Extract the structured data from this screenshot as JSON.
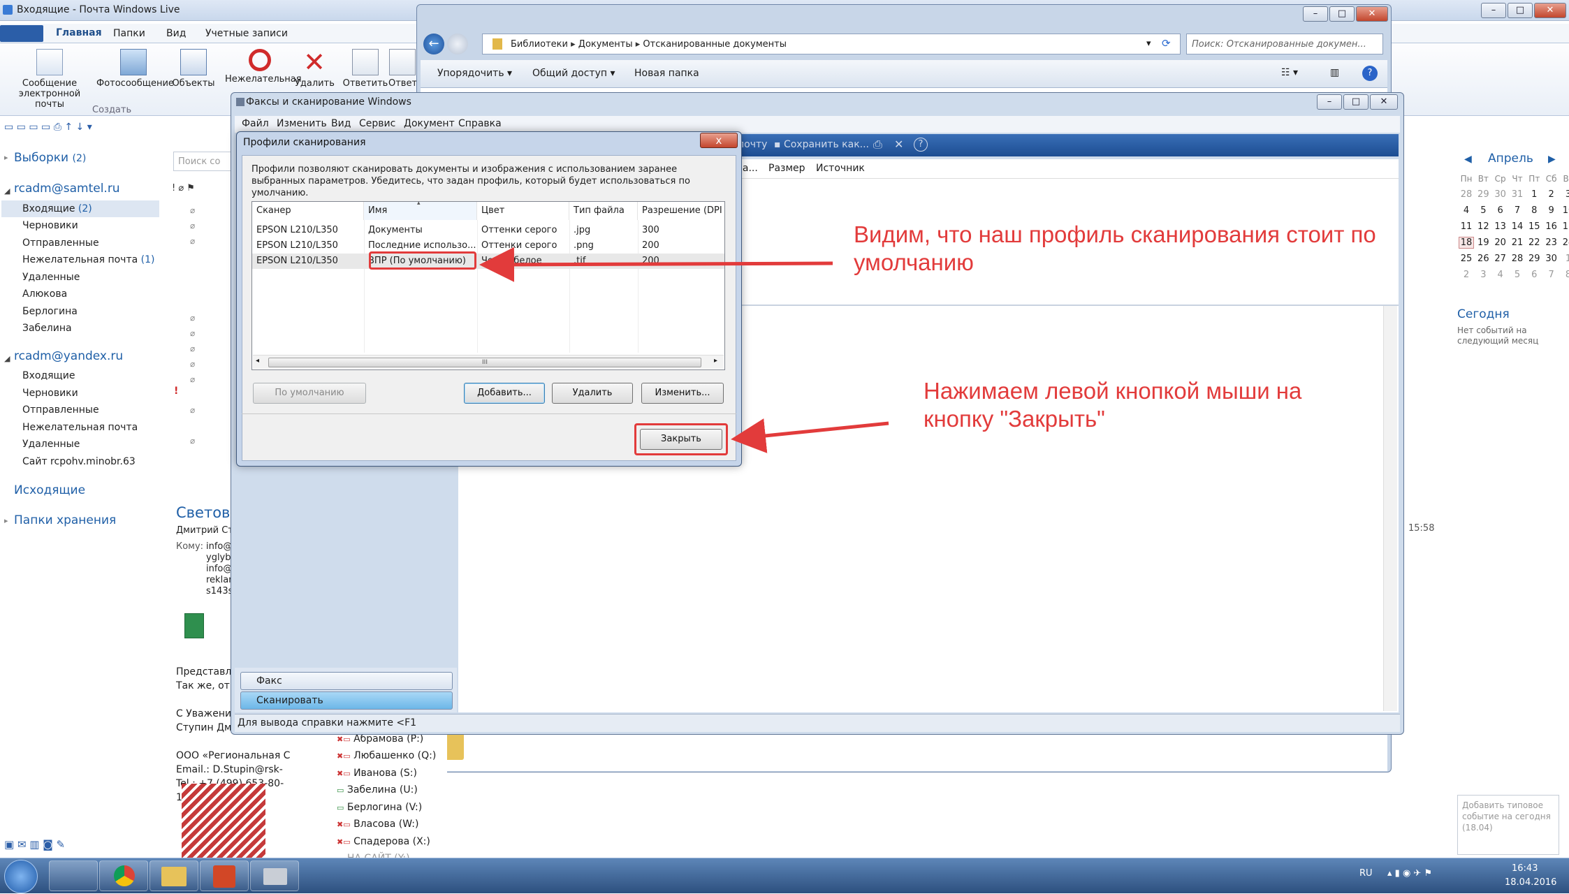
{
  "wlm": {
    "title": "Входящие - Почта Windows Live",
    "tabs": [
      "Главная",
      "Папки",
      "Вид",
      "Учетные записи"
    ],
    "ribbon": {
      "new_email": "Сообщение электронной почты",
      "photo_email": "Фотосообщение",
      "objects": "Объекты",
      "group_create": "Создать",
      "junk": "Нежелательная",
      "delete": "Удалить",
      "reply": "Ответить",
      "reply_all": "Ответ"
    },
    "search_placeholder": "Поиск со",
    "nav": {
      "quick_views": "Выборки",
      "quick_views_count": "(2)",
      "account1": "rcadm@samtel.ru",
      "account1_folders": [
        {
          "label": "Входящие",
          "count": "(2)"
        },
        {
          "label": "Черновики",
          "count": ""
        },
        {
          "label": "Отправленные",
          "count": ""
        },
        {
          "label": "Нежелательная почта",
          "count": "(1)"
        },
        {
          "label": "Удаленные",
          "count": ""
        },
        {
          "label": "Алюкова",
          "count": ""
        },
        {
          "label": "Берлогина",
          "count": ""
        },
        {
          "label": "Забелина",
          "count": ""
        }
      ],
      "account2": "rcadm@yandex.ru",
      "account2_folders": [
        "Входящие",
        "Черновики",
        "Отправленные",
        "Нежелательная почта",
        "Удаленные",
        "Сайт rcpohv.minobr.63"
      ],
      "outbox": "Исходящие",
      "storage": "Папки хранения"
    },
    "reading": {
      "subject": "Светово",
      "from": "Дмитрий Ст",
      "to_label": "Кому:",
      "to_lines": [
        "info@",
        "yglyb",
        "info@",
        "reklar",
        "s143s"
      ],
      "body": [
        "Представл",
        "Так же, отп",
        "",
        "С Уважени",
        "Ступин Дм",
        "",
        "ООО «Региональная С",
        "Email.: D.Stupin@rsk-",
        "Tel.: +7 (499) 653-80-15"
      ],
      "time": "15:58"
    },
    "calendar": {
      "month": "Апрель",
      "weekdays": [
        "Пн",
        "Вт",
        "Ср",
        "Чт",
        "Пт",
        "Сб",
        "Вс"
      ],
      "weeks": [
        [
          "28",
          "29",
          "30",
          "31",
          "1",
          "2",
          "3"
        ],
        [
          "4",
          "5",
          "6",
          "7",
          "8",
          "9",
          "10"
        ],
        [
          "11",
          "12",
          "13",
          "14",
          "15",
          "16",
          "17"
        ],
        [
          "18",
          "19",
          "20",
          "21",
          "22",
          "23",
          "24"
        ],
        [
          "25",
          "26",
          "27",
          "28",
          "29",
          "30",
          "1"
        ],
        [
          "2",
          "3",
          "4",
          "5",
          "6",
          "7",
          "8"
        ]
      ],
      "today_label": "Сегодня",
      "no_events": "Нет событий на следующий месяц",
      "add_event": "Добавить типовое событие на сегодня (18.04)"
    }
  },
  "explorer": {
    "breadcrumb": [
      "Библиотеки",
      "Документы",
      "Отсканированные документы"
    ],
    "search_placeholder": "Поиск: Отсканированные докумен...",
    "toolbar": [
      "Упорядочить",
      "Общий доступ",
      "Новая папка"
    ]
  },
  "fax": {
    "title": "Факсы и сканирование Windows",
    "menu": [
      "Файл",
      "Изменить",
      "Вид",
      "Сервис",
      "Документ",
      "Справка"
    ],
    "toolbar_items": [
      "почту",
      "Сохранить как..."
    ],
    "columns": [
      "ра...",
      "Размер",
      "Источник"
    ],
    "nav_fax": "Факс",
    "nav_scan": "Сканировать",
    "status": "Для вывода справки нажмите <F1"
  },
  "drives": [
    "Абрамова (P:)",
    "Любашенко (Q:)",
    "Иванова (S:)",
    "Забелина (U:)",
    "Берлогина (V:)",
    "Власова (W:)",
    "Спадерова (X:)",
    "НА САЙТ (Y:)"
  ],
  "dialog": {
    "title": "Профили сканирования",
    "close_glyph": "x",
    "description": "Профили позволяют сканировать документы и изображения с использованием заранее выбранных параметров. Убедитесь, что задан профиль, который будет использоваться по умолчанию.",
    "columns": [
      "Сканер",
      "Имя",
      "Цвет",
      "Тип файла",
      "Разрешение (DPI"
    ],
    "rows": [
      [
        "EPSON L210/L350",
        "Документы",
        "Оттенки серого",
        ".jpg",
        "300"
      ],
      [
        "EPSON L210/L350",
        "Последние использо...",
        "Оттенки серого",
        ".png",
        "200"
      ],
      [
        "EPSON L210/L350",
        "ВПР (По умолчанию)",
        "Черно-белое",
        ".tif",
        "200"
      ]
    ],
    "scroll_grip": "III",
    "btn_default": "По умолчанию",
    "btn_add": "Добавить...",
    "btn_delete": "Удалить",
    "btn_edit": "Изменить...",
    "btn_close": "Закрыть"
  },
  "annotations": {
    "note1": "Видим, что наш профиль сканирования  стоит по умолчанию",
    "note2": "Нажимаем левой кнопкой мыши  на кнопку \"Закрыть\"",
    "color": "#e23b3b"
  },
  "taskbar": {
    "lang": "RU",
    "time": "16:43",
    "date": "18.04.2016"
  }
}
